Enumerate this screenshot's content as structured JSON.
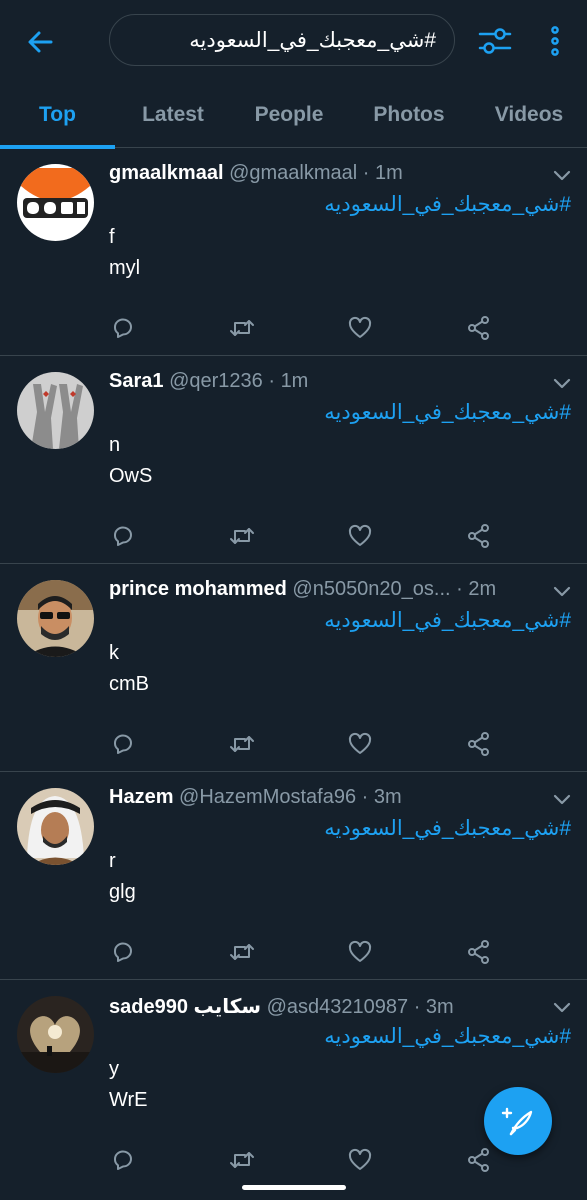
{
  "colors": {
    "background": "#15202b",
    "accent": "#1da1f2",
    "muted": "#8899a6",
    "divider": "#38444d"
  },
  "header": {
    "back_icon": "arrow-left-icon",
    "search_value": "#شي_معجبك_في_السعوديه",
    "filter_icon": "sliders-icon",
    "more_icon": "vertical-dots-icon"
  },
  "tabs": [
    {
      "label": "Top",
      "active": true
    },
    {
      "label": "Latest",
      "active": false
    },
    {
      "label": "People",
      "active": false
    },
    {
      "label": "Photos",
      "active": false
    },
    {
      "label": "Videos",
      "active": false
    }
  ],
  "tweets": [
    {
      "name": "gmaalkmaal",
      "handle": "@gmaalkmaal",
      "time": "1m",
      "hashtag": "#شي_معجبك_في_السعوديه",
      "line1": "f",
      "line2": "myl"
    },
    {
      "name": "Sara1",
      "handle": "@qer1236",
      "time": "1m",
      "hashtag": "#شي_معجبك_في_السعوديه",
      "line1": "n",
      "line2": "OwS"
    },
    {
      "name": "prince mohammed",
      "handle": "@n5050n20_os...",
      "time": "2m",
      "hashtag": "#شي_معجبك_في_السعوديه",
      "line1": "k",
      "line2": "cmB"
    },
    {
      "name": "Hazem",
      "handle": "@HazemMostafa96",
      "time": "3m",
      "hashtag": "#شي_معجبك_في_السعوديه",
      "line1": "r",
      "line2": "glg"
    },
    {
      "name": "sade990 سكايب",
      "handle": "@asd43210987",
      "time": "3m",
      "hashtag": "#شي_معجبك_في_السعوديه",
      "line1": "y",
      "line2": "WrE"
    }
  ],
  "fab": {
    "icon": "compose-feather-icon"
  }
}
